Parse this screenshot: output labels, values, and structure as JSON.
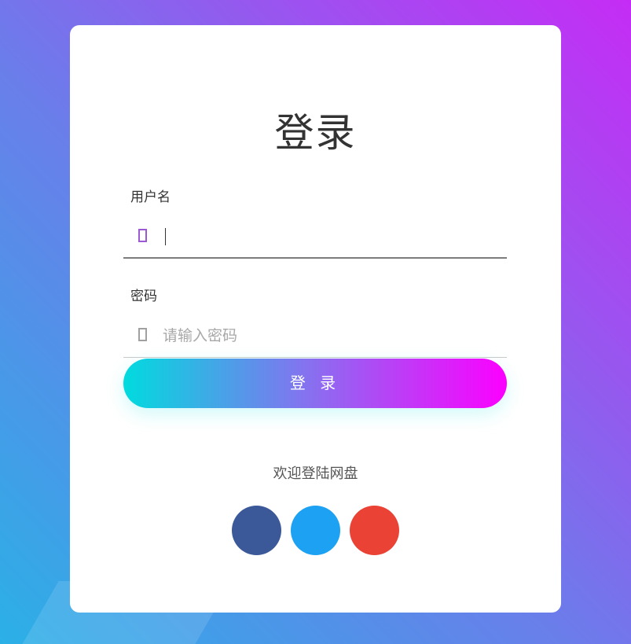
{
  "login": {
    "title": "登录",
    "username": {
      "label": "用户名",
      "value": "",
      "placeholder": "",
      "icon": "user-icon"
    },
    "password": {
      "label": "密码",
      "value": "",
      "placeholder": "请输入密码",
      "icon": "lock-icon"
    },
    "submit_label": "登 录",
    "welcome_text": "欢迎登陆网盘",
    "social_buttons": [
      {
        "name": "facebook-button",
        "color": "#3b5998"
      },
      {
        "name": "twitter-button",
        "color": "#1da1f2"
      },
      {
        "name": "google-button",
        "color": "#ea4335"
      }
    ]
  },
  "colors": {
    "gradient_start": "#00dbde",
    "gradient_end": "#fc00ff",
    "focus_icon": "#9b59d6"
  }
}
